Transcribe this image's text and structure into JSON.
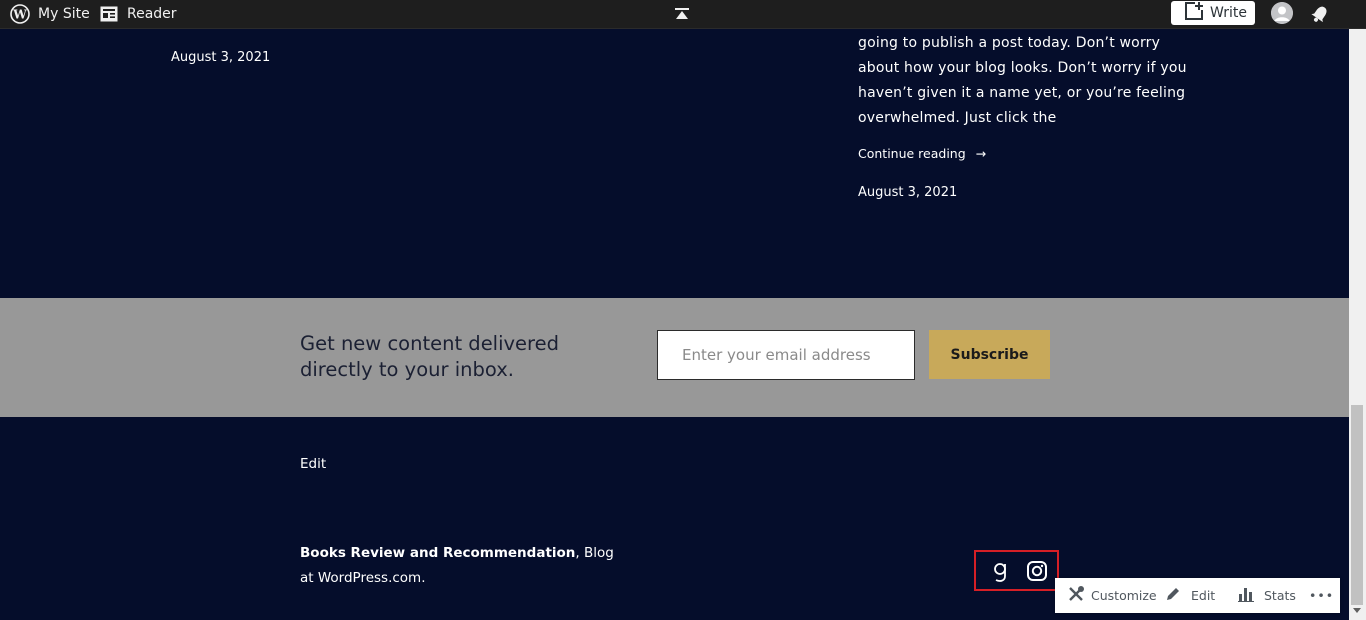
{
  "adminbar": {
    "my_site": "My Site",
    "reader": "Reader",
    "write": "Write"
  },
  "posts": {
    "left_date": "August 3, 2021",
    "excerpt": "going to publish a post today. Don’t worry about how your blog looks. Don’t worry if you haven’t given it a name yet, or you’re feeling overwhelmed. Just click the",
    "continue_label": "Continue reading",
    "continue_arrow": "→",
    "right_date": "August 3, 2021"
  },
  "subscribe": {
    "text": "Get new content delivered directly to your inbox.",
    "email_placeholder": "Enter your email address",
    "button": "Subscribe"
  },
  "footer": {
    "edit": "Edit",
    "site_name": "Books Review and Recommendation",
    "credit_rest": ", Blog at WordPress.com.",
    "social": [
      "goodreads-icon",
      "instagram-icon"
    ]
  },
  "customizer": {
    "customize": "Customize",
    "edit": "Edit",
    "stats": "Stats",
    "more": "•••"
  },
  "colors": {
    "background": "#050d2b",
    "subscribe_band": "#989898",
    "subscribe_button": "#c8a95a",
    "highlight": "#d61f26"
  }
}
